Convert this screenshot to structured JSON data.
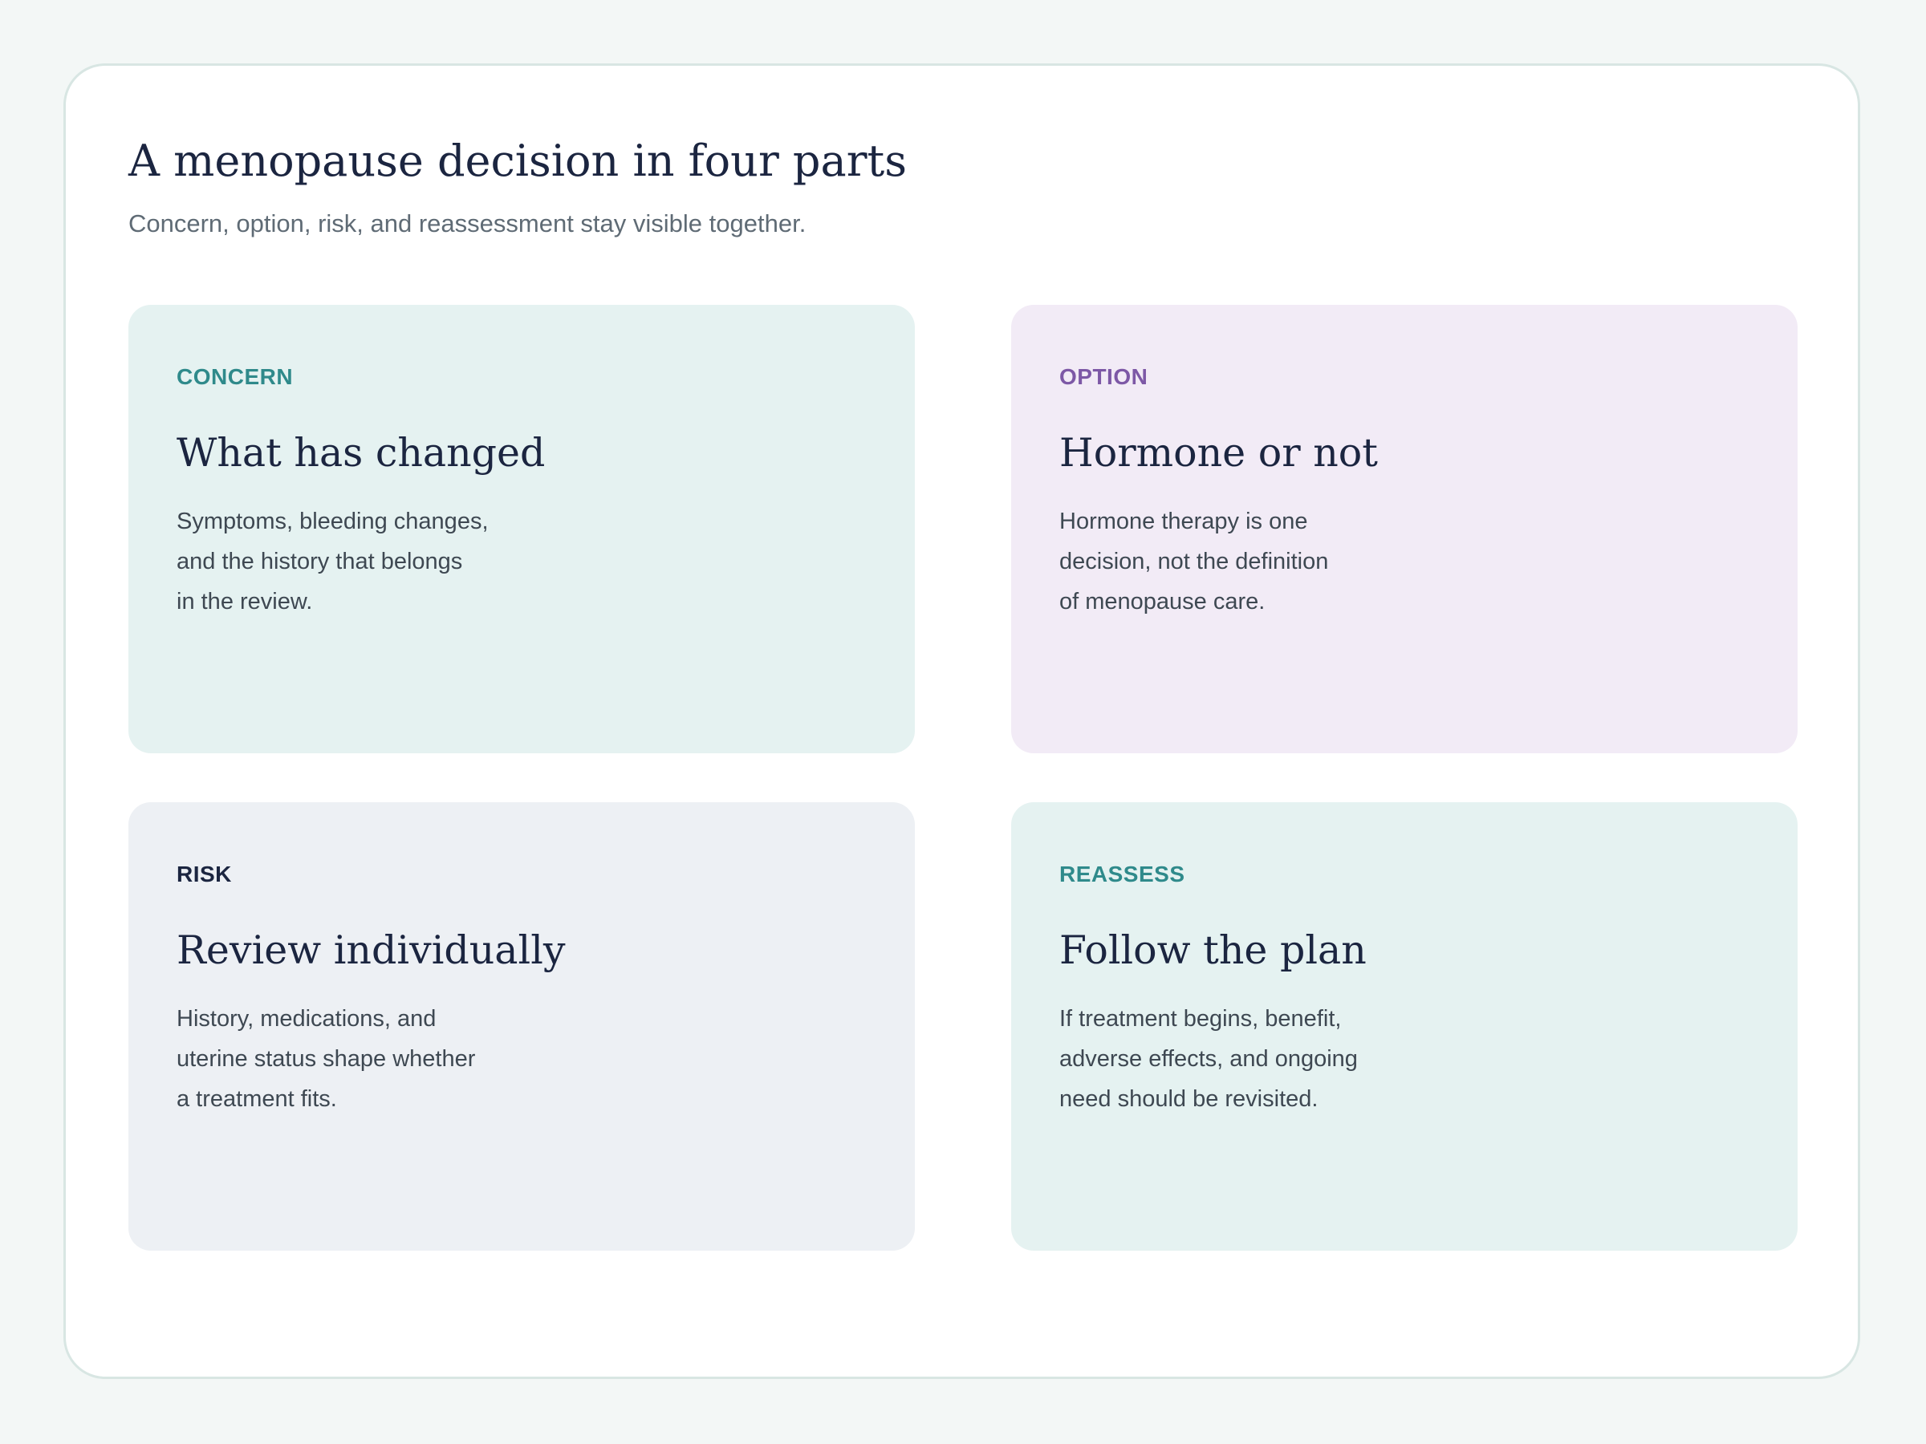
{
  "page": {
    "title": "A menopause decision in four parts",
    "subtitle": "Concern, option, risk, and reassessment stay visible together."
  },
  "colors": {
    "page_background": "#f3f7f6",
    "frame_border": "#d8e6e3",
    "teal_card": "#e5f2f1",
    "lavender_card": "#f2ebf6",
    "gray_card": "#edf0f4",
    "teal_label": "#2f8a8b",
    "purple_label": "#7d58a6",
    "navy_label": "#1b2540",
    "heading_text": "#1b2540",
    "body_text": "#3e4852"
  },
  "cards": [
    {
      "label": "CONCERN",
      "heading": "What has changed",
      "body_lines": [
        "Symptoms, bleeding changes,",
        "and the history that belongs",
        "in the review."
      ],
      "background": "#e5f2f1",
      "label_color": "#2f8a8b"
    },
    {
      "label": "OPTION",
      "heading": "Hormone or not",
      "body_lines": [
        "Hormone therapy is one",
        "decision, not the definition",
        "of menopause care."
      ],
      "background": "#f2ebf6",
      "label_color": "#7d58a6"
    },
    {
      "label": "RISK",
      "heading": "Review individually",
      "body_lines": [
        "History, medications, and",
        "uterine status shape whether",
        "a treatment fits."
      ],
      "background": "#edf0f4",
      "label_color": "#1b2540"
    },
    {
      "label": "REASSESS",
      "heading": "Follow the plan",
      "body_lines": [
        "If treatment begins, benefit,",
        "adverse effects, and ongoing",
        "need should be revisited."
      ],
      "background": "#e5f2f1",
      "label_color": "#2f8a8b"
    }
  ]
}
